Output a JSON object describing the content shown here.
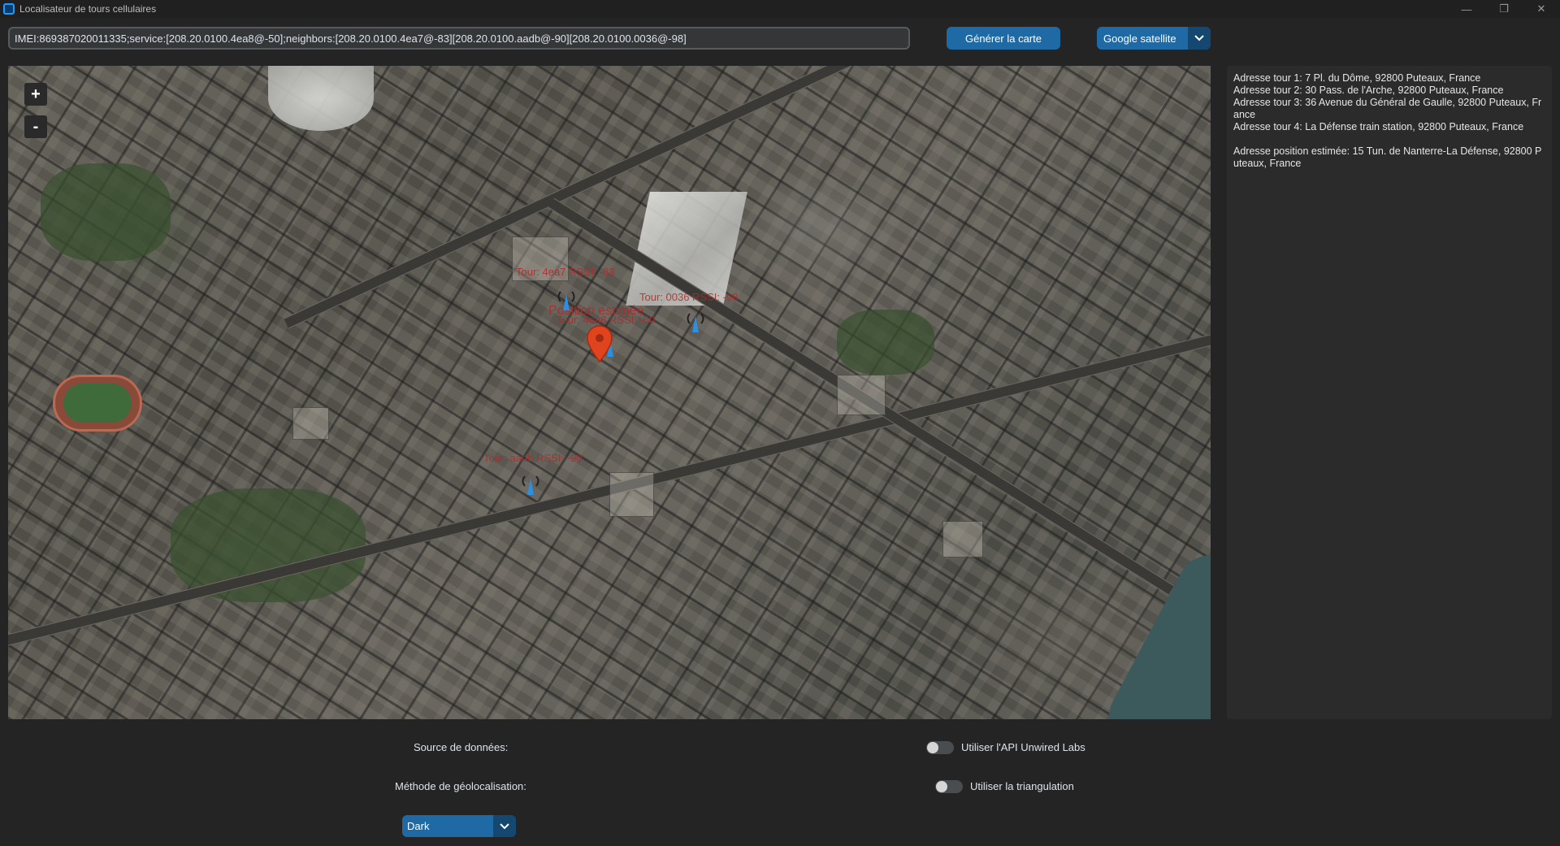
{
  "window": {
    "title": "Localisateur de tours cellulaires",
    "controls": {
      "minimize": "—",
      "maximize": "❐",
      "close": "✕"
    }
  },
  "toolbar": {
    "imei_value": "IMEI:869387020011335;service:[208.20.0100.4ea8@-50];neighbors:[208.20.0100.4ea7@-83][208.20.0100.aadb@-90][208.20.0100.0036@-98]",
    "generate_label": "Générer la carte",
    "map_type_selected": "Google satellite"
  },
  "map": {
    "zoom_in": "+",
    "zoom_out": "-",
    "labels": {
      "tower_4ea7": "Tour: 4ea7 RSSI: -83",
      "tower_0036": "Tour: 0036 RSSI: -98",
      "estimated_position": "Position estimée",
      "tower_4ea8": "Tour: 4ea8 RSSI: -50",
      "tower_aadb": "Tour: aadb RSSI: -90"
    },
    "accent_tower_color": "#2e8ee0",
    "accent_pin_color": "#e0441f"
  },
  "info_panel": {
    "lines": [
      "Adresse tour 1: 7 Pl. du Dôme, 92800 Puteaux, France",
      "Adresse tour 2: 30 Pass. de l'Arche, 92800 Puteaux, France",
      "Adresse tour 3: 36 Avenue du Général de Gaulle, 92800 Puteaux, France",
      "Adresse tour 4: La Défense train station, 92800 Puteaux, France"
    ],
    "estimated": "Adresse position estimée: 15 Tun. de Nanterre-La Défense, 92800 Puteaux, France"
  },
  "bottom": {
    "data_source_label": "Source de données:",
    "unwired_switch_label": "Utiliser l'API Unwired Labs",
    "unwired_switch_on": false,
    "geoloc_label": "Méthode de géolocalisation:",
    "triangulation_switch_label": "Utiliser la triangulation",
    "triangulation_switch_on": false,
    "theme_selected": "Dark"
  }
}
